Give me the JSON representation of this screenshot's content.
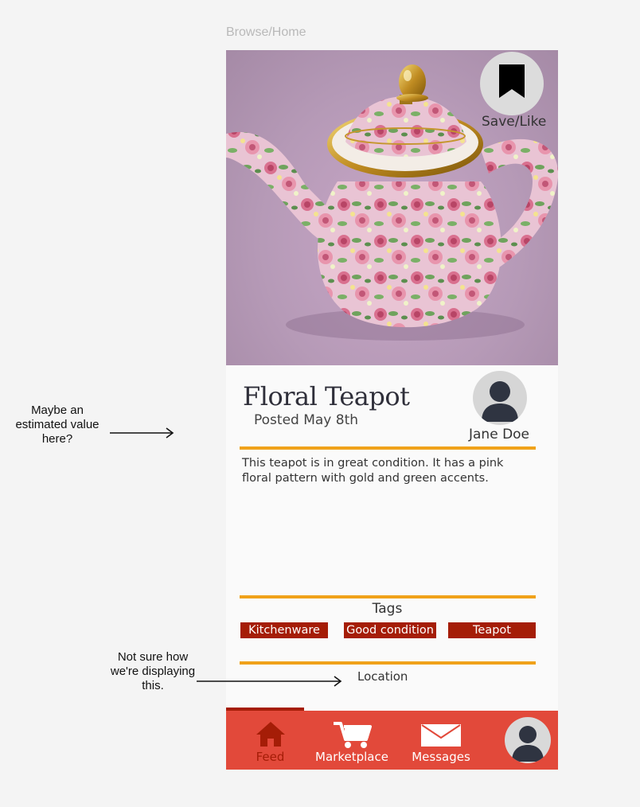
{
  "breadcrumb": "Browse/Home",
  "listing": {
    "save_label": "Save/Like",
    "title": "Floral Teapot",
    "posted": "Posted May 8th",
    "seller": "Jane Doe",
    "description": "This teapot is in great condition. It has a pink floral pattern with gold and green accents.",
    "tags_heading": "Tags",
    "tags": [
      "Kitchenware",
      "Good condition",
      "Teapot"
    ],
    "location_label": "Location"
  },
  "tabbar": {
    "feed": "Feed",
    "marketplace": "Marketplace",
    "messages": "Messages"
  },
  "annotations": {
    "estimated_value": "Maybe an estimated value here?",
    "location_note": "Not sure how we're displaying this."
  },
  "colors": {
    "accent_rule": "#f0a21a",
    "tag_bg": "#a51d07",
    "tabbar_bg": "#e2493a",
    "active_tab": "#a51d07"
  },
  "icons": {
    "save": "bookmark-icon",
    "seller": "user-avatar-icon",
    "feed": "home-icon",
    "marketplace": "cart-icon",
    "messages": "envelope-icon",
    "profile": "user-avatar-icon"
  }
}
